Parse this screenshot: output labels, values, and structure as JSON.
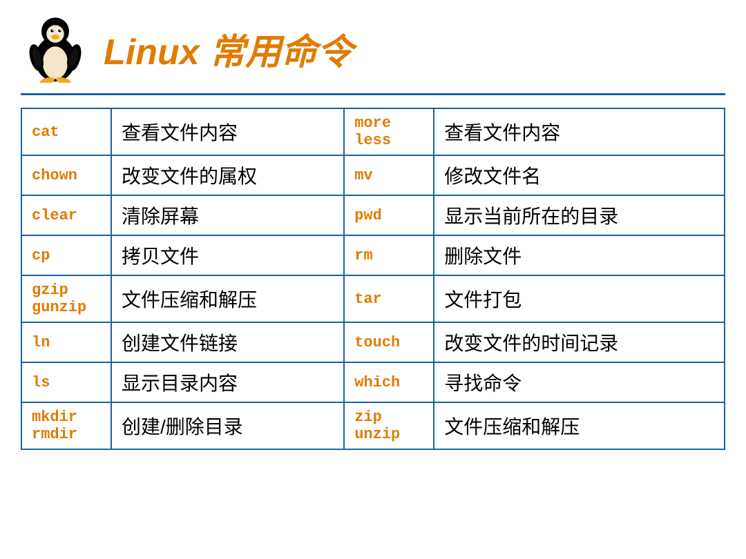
{
  "header": {
    "title": "Linux 常用命令"
  },
  "table": {
    "rows": [
      {
        "cmd1": "cat",
        "desc1": "查看文件内容",
        "cmd2": "more\nless",
        "desc2": "查看文件内容"
      },
      {
        "cmd1": "chown",
        "desc1": "改变文件的属权",
        "cmd2": "mv",
        "desc2": "修改文件名"
      },
      {
        "cmd1": "clear",
        "desc1": "清除屏幕",
        "cmd2": "pwd",
        "desc2": "显示当前所在的目录"
      },
      {
        "cmd1": "cp",
        "desc1": "拷贝文件",
        "cmd2": "rm",
        "desc2": "删除文件"
      },
      {
        "cmd1": "gzip\ngunzip",
        "desc1": "文件压缩和解压",
        "cmd2": "tar",
        "desc2": "文件打包"
      },
      {
        "cmd1": "ln",
        "desc1": "创建文件链接",
        "cmd2": "touch",
        "desc2": "改变文件的时间记录"
      },
      {
        "cmd1": "ls",
        "desc1": "显示目录内容",
        "cmd2": "which",
        "desc2": "寻找命令"
      },
      {
        "cmd1": "mkdir\nrmdir",
        "desc1": "创建/删除目录",
        "cmd2": "zip\nunzip",
        "desc2": "文件压缩和解压"
      }
    ]
  }
}
